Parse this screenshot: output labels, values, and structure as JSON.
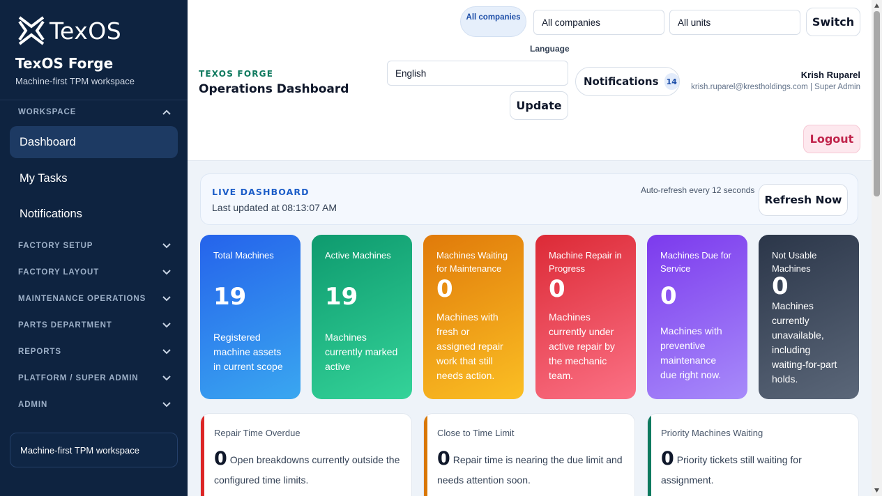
{
  "brand": {
    "logo_text": "TexOS",
    "title": "TexOS Forge",
    "subtitle": "Machine-first TPM workspace"
  },
  "sidebar": {
    "workspace_label": "WORKSPACE",
    "items": [
      {
        "label": "Dashboard",
        "active": true
      },
      {
        "label": "My Tasks",
        "active": false
      },
      {
        "label": "Notifications",
        "active": false
      }
    ],
    "sections": [
      "FACTORY SETUP",
      "FACTORY LAYOUT",
      "MAINTENANCE OPERATIONS",
      "PARTS DEPARTMENT",
      "REPORTS",
      "PLATFORM / SUPER ADMIN",
      "ADMIN"
    ],
    "footer": "Machine-first TPM workspace"
  },
  "header": {
    "scope_pill": "All companies",
    "company_select": "All companies",
    "unit_select": "All units",
    "switch_label": "Switch",
    "language_label": "Language",
    "language_value": "English",
    "update_label": "Update",
    "eyebrow": "TEXOS FORGE",
    "title": "Operations Dashboard",
    "notifications_label": "Notifications",
    "notifications_count": "14",
    "user_name": "Krish Ruparel",
    "user_meta": "krish.ruparel@krestholdings.com | Super Admin",
    "logout_label": "Logout"
  },
  "live": {
    "title": "LIVE DASHBOARD",
    "updated": "Last updated at 08:13:07 AM",
    "auto_refresh": "Auto-refresh every 12 seconds",
    "refresh_label": "Refresh Now"
  },
  "stats": [
    {
      "label": "Total Machines",
      "value": "19",
      "desc": "Registered machine assets in current scope",
      "color": "#2563eb"
    },
    {
      "label": "Active Machines",
      "value": "19",
      "desc": "Machines currently marked active",
      "color": "#0e9a6e"
    },
    {
      "label": "Machines Waiting for Maintenance",
      "value": "0",
      "desc": "Machines with fresh or assigned repair work that still needs action.",
      "color": "#e07a0a"
    },
    {
      "label": "Machine Repair in Progress",
      "value": "0",
      "desc": "Machines currently under active repair by the mechanic team.",
      "color": "#dc2a36"
    },
    {
      "label": "Machines Due for Service",
      "value": "0",
      "desc": "Machines with preventive maintenance due right now.",
      "color": "#7c3aed"
    },
    {
      "label": "Not Usable Machines",
      "value": "0",
      "desc": "Machines currently unavailable, including waiting-for-part holds.",
      "color": "#2b3649"
    }
  ],
  "alerts": [
    {
      "title": "Repair Time Overdue",
      "value": "0",
      "text": "Open breakdowns currently outside the configured time limits.",
      "color": "#dc2626"
    },
    {
      "title": "Close to Time Limit",
      "value": "0",
      "text": "Repair time is nearing the due limit and needs attention soon.",
      "color": "#d97706"
    },
    {
      "title": "Priority Machines Waiting",
      "value": "0",
      "text": "Priority tickets still waiting for assignment.",
      "color": "#0f7a5f"
    }
  ]
}
